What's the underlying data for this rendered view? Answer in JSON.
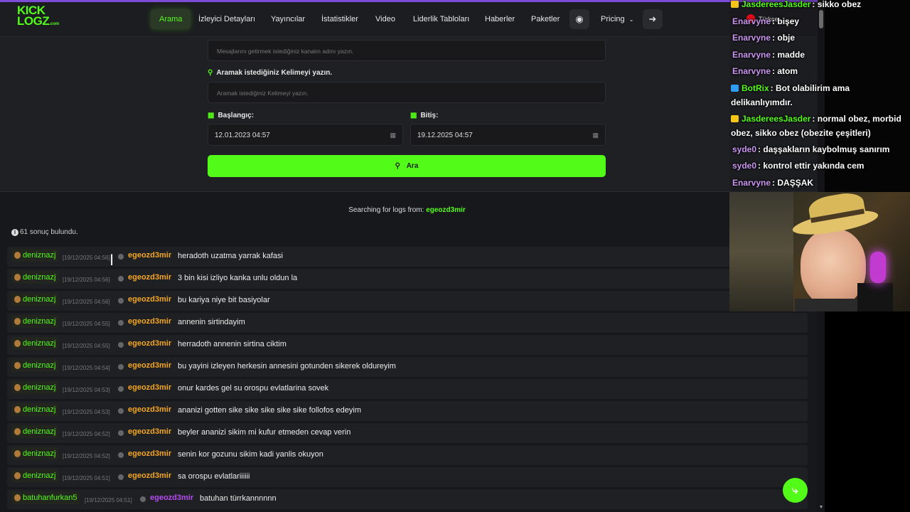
{
  "colors": {
    "accent": "#53fc18",
    "username": "#f5a623",
    "purple": "#b44cf0"
  },
  "logo": {
    "line1": "KICK",
    "line2": "LOGZ",
    "domain": ".com"
  },
  "nav": {
    "items": [
      "Arama",
      "İzleyici Detayları",
      "Yayıncılar",
      "İstatistikler",
      "Video",
      "Liderlik Tabloları",
      "Haberler",
      "Paketler"
    ],
    "pricing": "Pricing",
    "discord_icon": "discord-icon",
    "login_icon": "sign-in-icon"
  },
  "form": {
    "channel_placeholder": "Mesajlarını getirmek istediğiniz kanalın adını yazın.",
    "keyword_label": "Aramak istediğiniz Kelimeyi yazın.",
    "keyword_placeholder": "Aramak istediğiniz Kelimeyi yazın.",
    "start_label": "Başlangıç:",
    "start_value": "12.01.2023 04:57",
    "end_label": "Bitiş:",
    "end_value": "19.12.2025 04:57",
    "search_button": "Ara"
  },
  "results": {
    "searching_prefix": "Searching for logs from:",
    "searching_user": "egeozd3mir",
    "count_text": "61 sonuç bulundu.",
    "rows": [
      {
        "user": "deniznazj",
        "ts": "[19/12/2025 04:56]",
        "target": "egeozd3mir",
        "msg": "heradoth uzatma yarrak kafasi"
      },
      {
        "user": "deniznazj",
        "ts": "[19/12/2025 04:56]",
        "target": "egeozd3mir",
        "msg": "3 bin kisi izliyo kanka unlu oldun la"
      },
      {
        "user": "deniznazj",
        "ts": "[19/12/2025 04:56]",
        "target": "egeozd3mir",
        "msg": "bu kariya niye bit basiyolar"
      },
      {
        "user": "deniznazj",
        "ts": "[19/12/2025 04:55]",
        "target": "egeozd3mir",
        "msg": "annenin sirtindayim"
      },
      {
        "user": "deniznazj",
        "ts": "[19/12/2025 04:55]",
        "target": "egeozd3mir",
        "msg": "herradoth annenin sirtina ciktim"
      },
      {
        "user": "deniznazj",
        "ts": "[19/12/2025 04:54]",
        "target": "egeozd3mir",
        "msg": "bu yayini izleyen herkesin annesini gotunden sikerek oldureyim"
      },
      {
        "user": "deniznazj",
        "ts": "[19/12/2025 04:53]",
        "target": "egeozd3mir",
        "msg": "onur kardes gel su orospu evlatlarina sovek"
      },
      {
        "user": "deniznazj",
        "ts": "[19/12/2025 04:53]",
        "target": "egeozd3mir",
        "msg": "ananizi gotten sike sike sike sike sike follofos edeyim"
      },
      {
        "user": "deniznazj",
        "ts": "[19/12/2025 04:52]",
        "target": "egeozd3mir",
        "msg": "beyler ananizi sikim mi kufur etmeden cevap verin"
      },
      {
        "user": "deniznazj",
        "ts": "[19/12/2025 04:52]",
        "target": "egeozd3mir",
        "msg": "senin kor gozunu sikim kadi yanlis okuyon"
      },
      {
        "user": "deniznazj",
        "ts": "[19/12/2025 04:51]",
        "target": "egeozd3mir",
        "msg": "sa orospu evlatlariiiiii"
      },
      {
        "user": "batuhanfurkan5",
        "ts": "[19/12/2025 04:51]",
        "target": "egeozd3mir",
        "msg": "batuhan türrkannnnnn"
      }
    ]
  },
  "overlay": {
    "language": "Türkçe",
    "chat": [
      {
        "name": "JasdereesJasder",
        "color": "#53fc18",
        "badge": "#f5c518",
        "text": "sikko obez"
      },
      {
        "name": "Enarvyne",
        "color": "#c995f0",
        "badge": "",
        "text": "bişey"
      },
      {
        "name": "Enarvyne",
        "color": "#c995f0",
        "badge": "",
        "text": "obje"
      },
      {
        "name": "Enarvyne",
        "color": "#c995f0",
        "badge": "",
        "text": "madde"
      },
      {
        "name": "Enarvyne",
        "color": "#c995f0",
        "badge": "",
        "text": "atom"
      },
      {
        "name": "BotRix",
        "color": "#53fc18",
        "badge": "#2e9df0",
        "text": "Bot olabilirim ama delikanlıyımdır."
      },
      {
        "name": "JasdereesJasder",
        "color": "#53fc18",
        "badge": "#f5c518",
        "text": "normal obez, morbid obez, sikko obez (obezite çeşitleri)"
      },
      {
        "name": "syde0",
        "color": "#c995f0",
        "badge": "",
        "text": "daşşakların kaybolmuş sanırım"
      },
      {
        "name": "syde0",
        "color": "#c995f0",
        "badge": "",
        "text": "kontrol ettir yakında cem"
      },
      {
        "name": "Enarvyne",
        "color": "#c995f0",
        "badge": "",
        "text": "DAŞŞAK"
      }
    ]
  }
}
